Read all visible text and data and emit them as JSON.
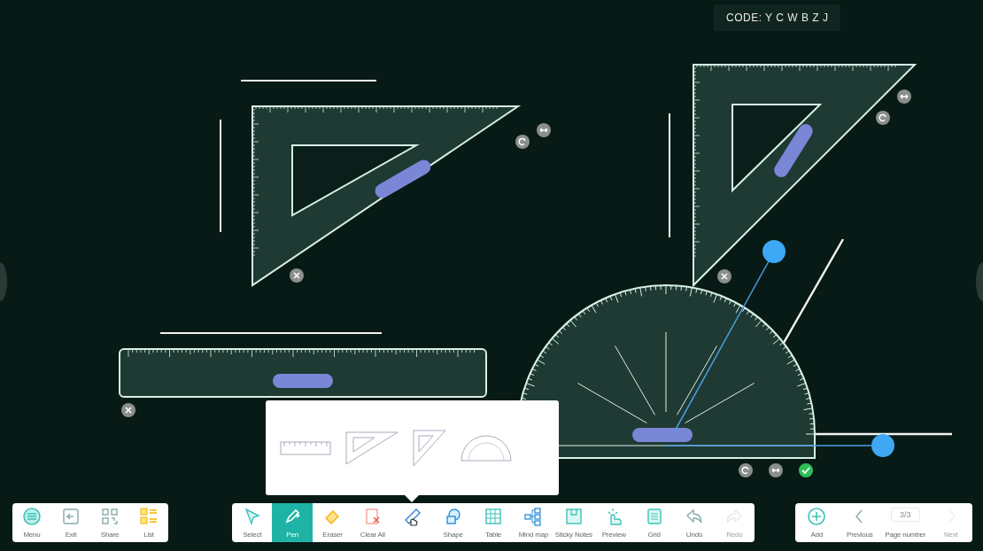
{
  "session": {
    "code": "CODE: Y C W B Z J"
  },
  "canvas_items": [
    {
      "kind": "set_square"
    },
    {
      "kind": "set_square"
    },
    {
      "kind": "ruler"
    },
    {
      "kind": "protractor"
    }
  ],
  "tool_popup": {
    "items": [
      {
        "kind": "ruler",
        "selected": false
      },
      {
        "kind": "set_square",
        "selected": false
      },
      {
        "kind": "set_square_right",
        "selected": false
      },
      {
        "kind": "protractor",
        "selected": false
      }
    ]
  },
  "left_toolbar": [
    {
      "label": "Menu"
    },
    {
      "label": "Exit"
    },
    {
      "label": "Share"
    },
    {
      "label": "List"
    }
  ],
  "main_toolbar": [
    {
      "label": "Select",
      "selected": false,
      "disabled": false
    },
    {
      "label": "Pen",
      "selected": true,
      "disabled": false
    },
    {
      "label": "Eraser",
      "selected": false,
      "disabled": false
    },
    {
      "label": "Clear All",
      "selected": false,
      "disabled": false
    },
    {
      "selected": false,
      "disabled": false
    },
    {
      "label": "Shape",
      "selected": false,
      "disabled": false
    },
    {
      "label": "Table",
      "selected": false,
      "disabled": false
    },
    {
      "label": "Mind map",
      "selected": false,
      "disabled": false
    },
    {
      "label": "Sticky Notes",
      "selected": false,
      "disabled": false
    },
    {
      "label": "Preview",
      "selected": false,
      "disabled": false
    },
    {
      "label": "Grid",
      "selected": false,
      "disabled": false
    },
    {
      "label": "Undo",
      "selected": false,
      "disabled": false
    },
    {
      "label": "Redo",
      "selected": false,
      "disabled": true
    }
  ],
  "page_toolbar": {
    "add": {
      "label": "Add"
    },
    "previous": {
      "label": "Previous",
      "disabled": false
    },
    "page_number": {
      "value": "3/3",
      "label": "Page number"
    },
    "next": {
      "label": "Next",
      "disabled": true
    }
  }
}
